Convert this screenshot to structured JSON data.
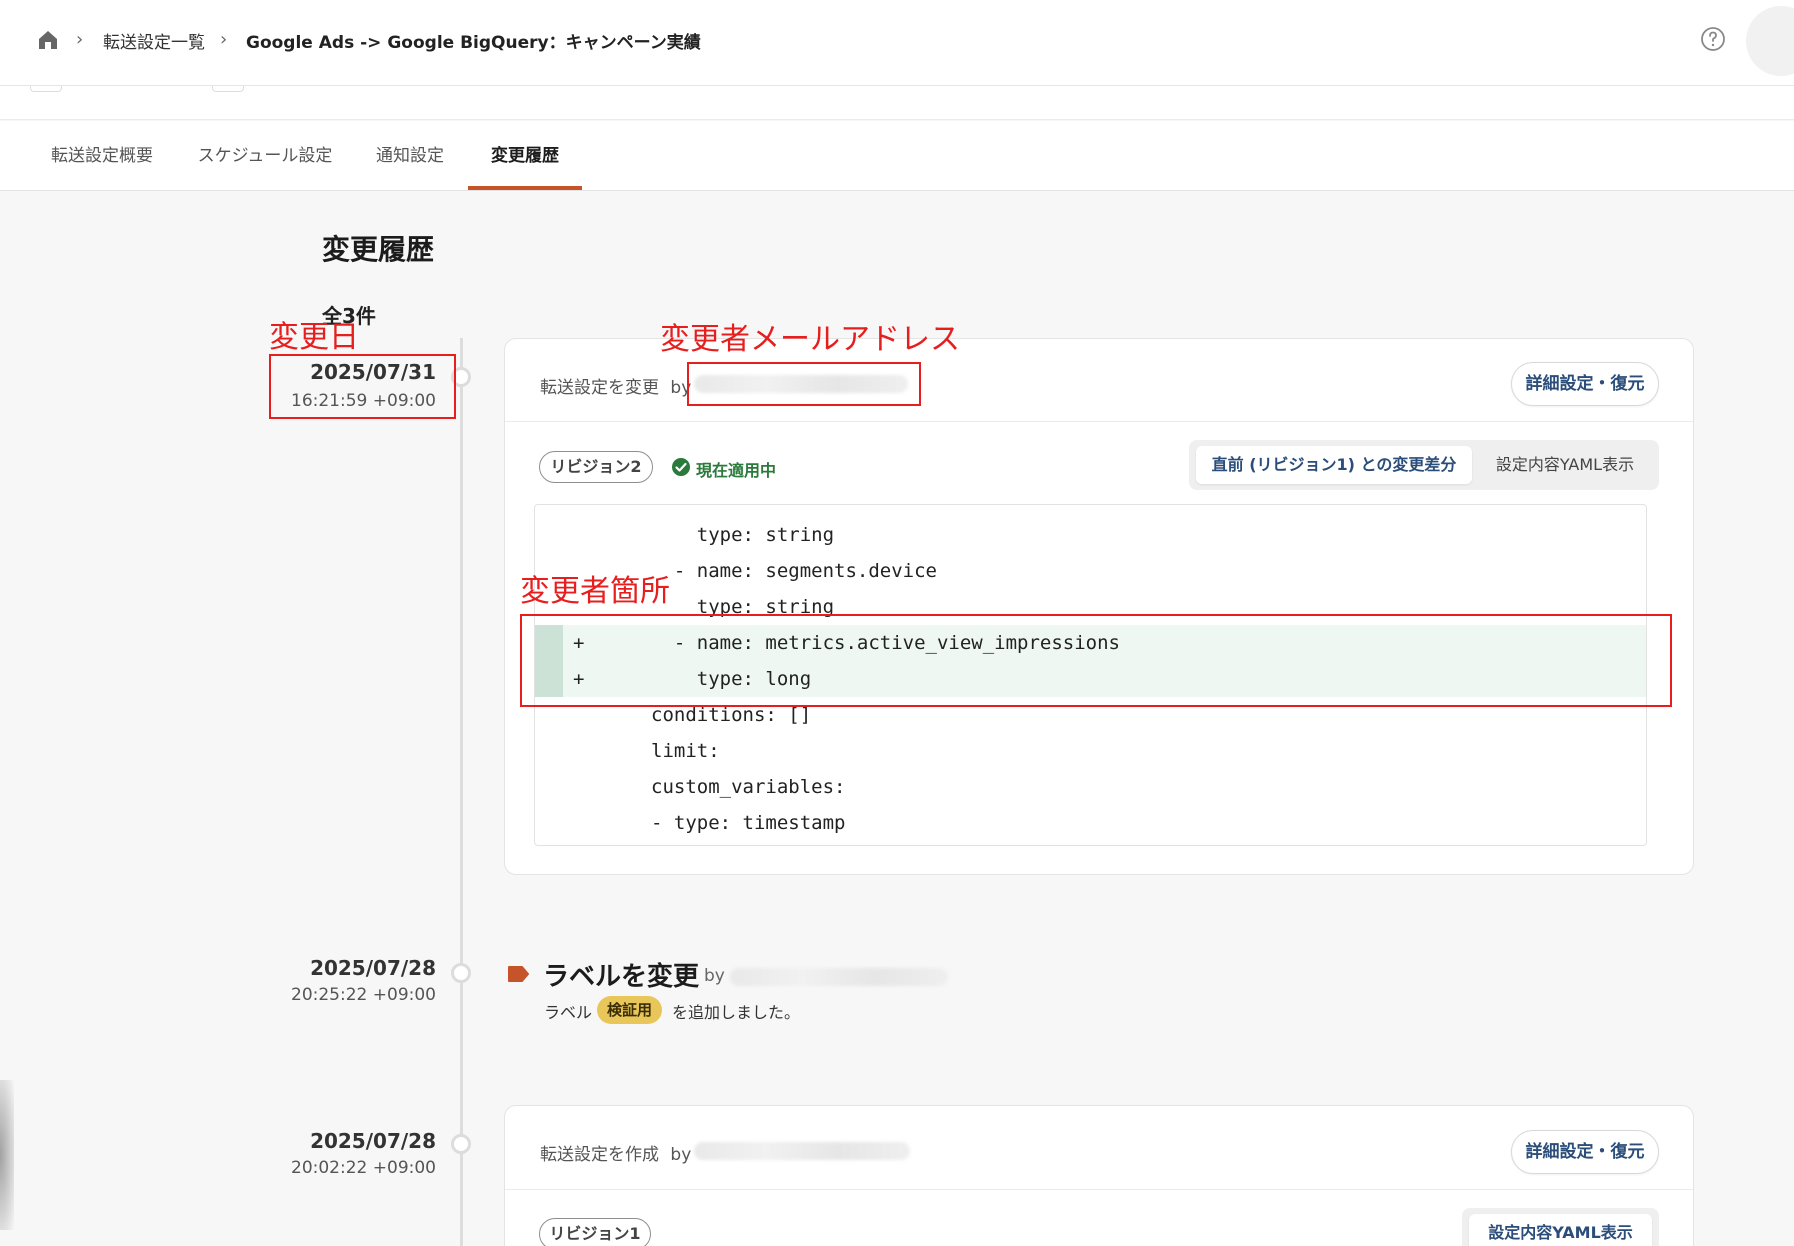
{
  "breadcrumb": {
    "items": [
      "転送設定一覧",
      "Google Ads -> Google BigQuery：キャンペーン実績"
    ]
  },
  "tabs": [
    {
      "label": "転送設定概要"
    },
    {
      "label": "スケジュール設定"
    },
    {
      "label": "通知設定"
    },
    {
      "label": "変更履歴",
      "active": true
    }
  ],
  "page": {
    "title": "変更履歴",
    "total": "全3件"
  },
  "entries": [
    {
      "date": "2025/07/31",
      "time": "16:21:59 +09:00",
      "action": "転送設定を変更",
      "by": "by",
      "restore_label": "詳細設定・復元",
      "revision": "リビジョン2",
      "applied": "現在適用中",
      "diff_label": "直前 (リビジョン1) との変更差分",
      "yaml_label": "設定内容YAML表示",
      "code": [
        {
          "marker": "",
          "text": "    type: string",
          "added": false
        },
        {
          "marker": "",
          "text": "  - name: segments.device",
          "added": false
        },
        {
          "marker": "",
          "text": "    type: string",
          "added": false
        },
        {
          "marker": "+",
          "text": "  - name: metrics.active_view_impressions",
          "added": true
        },
        {
          "marker": "+",
          "text": "    type: long",
          "added": true
        },
        {
          "marker": "",
          "text": "conditions: []",
          "added": false
        },
        {
          "marker": "",
          "text": "limit:",
          "added": false
        },
        {
          "marker": "",
          "text": "custom_variables:",
          "added": false
        },
        {
          "marker": "",
          "text": "- type: timestamp",
          "added": false
        }
      ]
    },
    {
      "date": "2025/07/28",
      "time": "20:25:22 +09:00",
      "title": "ラベルを変更",
      "by": "by",
      "desc_prefix": "ラベル",
      "chip": "検証用",
      "desc_suffix": "を追加しました。"
    },
    {
      "date": "2025/07/28",
      "time": "20:02:22 +09:00",
      "action": "転送設定を作成",
      "by": "by",
      "restore_label": "詳細設定・復元",
      "revision": "リビジョン1",
      "yaml_label": "設定内容YAML表示"
    }
  ],
  "annotations": {
    "date": "変更日",
    "email": "変更者メールアドレス",
    "diff": "変更者箇所"
  },
  "colors": {
    "accent": "#c5542a",
    "annotation": "#e61e1e",
    "link": "#2a4d79",
    "applied": "#2a7a3c",
    "chip": "#e9c65a"
  }
}
